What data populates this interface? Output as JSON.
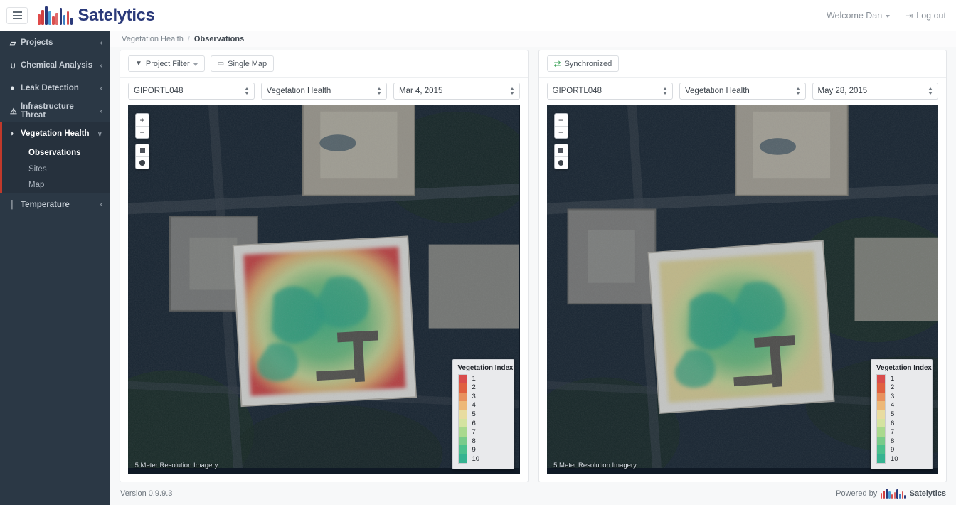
{
  "app": {
    "brand_name": "Satelytics",
    "brand_bars": [
      "#e04a4a",
      "#cf4040",
      "#2b3a7a",
      "#4a9fd8",
      "#d94f4f",
      "#e06b6b",
      "#2b3a7a",
      "#3f7fc4",
      "#d94f4f",
      "#2b3a7a"
    ],
    "menu_icon": "hamburger-icon"
  },
  "header": {
    "welcome_label": "Welcome Dan",
    "logout_label": "Log out",
    "logout_icon": "logout-icon"
  },
  "sidebar": {
    "items": [
      {
        "label": "Projects",
        "icon": "folder-icon",
        "glyph": "▱",
        "chevron": "‹"
      },
      {
        "label": "Chemical Analysis",
        "icon": "flask-icon",
        "glyph": "∪",
        "chevron": "‹"
      },
      {
        "label": "Leak Detection",
        "icon": "droplet-icon",
        "glyph": "●",
        "chevron": "‹"
      },
      {
        "label": "Infrastructure Threat",
        "icon": "warning-triangle-icon",
        "glyph": "⚠",
        "chevron": "‹"
      },
      {
        "label": "Vegetation Health",
        "icon": "leaf-icon",
        "glyph": "◗",
        "chevron": "∨",
        "active": true
      },
      {
        "label": "Temperature",
        "icon": "thermometer-icon",
        "glyph": "│",
        "chevron": "‹"
      }
    ],
    "subitems": [
      {
        "label": "Observations",
        "active": true
      },
      {
        "label": "Sites",
        "active": false
      },
      {
        "label": "Map",
        "active": false
      }
    ]
  },
  "breadcrumb": {
    "parent": "Vegetation Health",
    "separator": "/",
    "current": "Observations"
  },
  "panels": [
    {
      "id": "left-map-panel",
      "toolbar": [
        {
          "label": "Project Filter",
          "icon": "filter-icon",
          "glyph": "▼",
          "caret": "⌄"
        },
        {
          "label": "Single Map",
          "icon": "monitor-icon",
          "glyph": "▭"
        }
      ],
      "selects": [
        {
          "name": "site-select",
          "value": "GIPORTL048"
        },
        {
          "name": "analysis-select",
          "value": "Vegetation Health"
        },
        {
          "name": "date-select",
          "value": "Mar 4, 2015"
        }
      ],
      "map": {
        "attribution": ".5 Meter Resolution Imagery",
        "controls": [
          {
            "name": "zoom-in-button",
            "glyph": "+"
          },
          {
            "name": "zoom-out-button",
            "glyph": "−"
          },
          {
            "name": "draw-rectangle-button",
            "glyph": "square"
          },
          {
            "name": "draw-point-button",
            "glyph": "circle"
          }
        ]
      }
    },
    {
      "id": "right-map-panel",
      "toolbar": [
        {
          "label": "Synchronized",
          "icon": "sync-icon",
          "glyph": "⇄"
        }
      ],
      "selects": [
        {
          "name": "site-select",
          "value": "GIPORTL048"
        },
        {
          "name": "analysis-select",
          "value": "Vegetation Health"
        },
        {
          "name": "date-select",
          "value": "May 28, 2015"
        }
      ],
      "map": {
        "attribution": ".5 Meter Resolution Imagery",
        "controls": [
          {
            "name": "zoom-in-button",
            "glyph": "+"
          },
          {
            "name": "zoom-out-button",
            "glyph": "−"
          },
          {
            "name": "draw-rectangle-button",
            "glyph": "square"
          },
          {
            "name": "draw-point-button",
            "glyph": "circle"
          }
        ]
      }
    }
  ],
  "legend": {
    "title": "Vegetation Index",
    "labels": [
      "1",
      "2",
      "3",
      "4",
      "5",
      "6",
      "7",
      "8",
      "9",
      "10"
    ],
    "colors": [
      "#d94c4c",
      "#e06040",
      "#e8915e",
      "#edb878",
      "#e8dca0",
      "#d4e3a0",
      "#a9d98e",
      "#78cb8a",
      "#4cc08d",
      "#36b391"
    ]
  },
  "footer": {
    "version": "Version 0.9.9.3",
    "powered_prefix": "Powered by",
    "powered_brand": "Satelytics"
  }
}
